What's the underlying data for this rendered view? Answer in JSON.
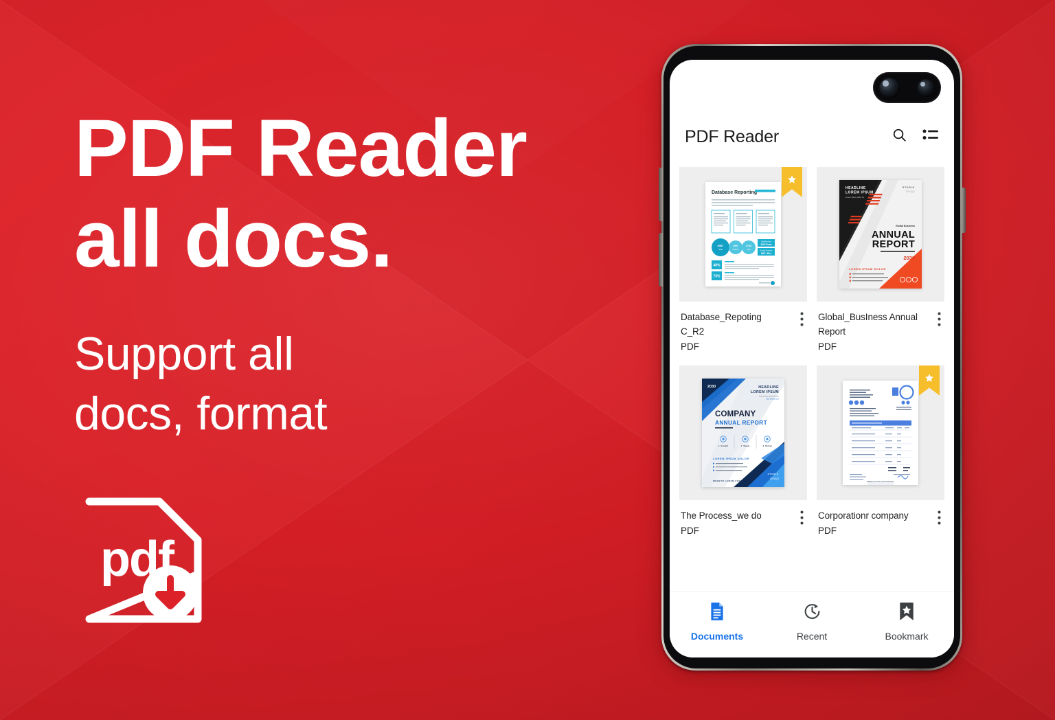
{
  "theme": {
    "background_red": "#DC2128",
    "accent_blue": "#1A73E8",
    "bookmark_yellow": "#F7BE2C",
    "text_dark": "#202124"
  },
  "hero": {
    "headline": "PDF Reader\nall docs.",
    "subheadline": "Support all\ndocs, format",
    "logo_text": "pdf",
    "logo_icon": "pdf-document-download-icon"
  },
  "phone": {
    "camera_icon": "dual-camera-punch-hole",
    "buttons": [
      "volume-up",
      "volume-down",
      "power"
    ]
  },
  "app": {
    "title": "PDF Reader",
    "actions": [
      {
        "name": "search-icon",
        "label": "Search"
      },
      {
        "name": "list-view-icon",
        "label": "List view"
      }
    ],
    "documents": [
      {
        "name": "Database_Repoting\nC_R2",
        "type": "PDF",
        "bookmarked": true,
        "thumbnail": "database-reporting-infographic",
        "thumb_title": "Database Reporting",
        "menu_icon": "kebab-menu-icon"
      },
      {
        "name": "Global_BusIness Annual\nReport",
        "type": "PDF",
        "bookmarked": false,
        "thumbnail": "annual-report-red-black-cover",
        "thumb_title": "ANNUAL REPORT",
        "thumb_subtitle": "Global Business",
        "thumb_year": "2030",
        "thumb_headline": "HEADLINE LOREM IPSUM",
        "thumb_studio": "STUDIO design",
        "thumb_footer": "LOREM IPSUM DOLOR",
        "menu_icon": "kebab-menu-icon"
      },
      {
        "name": "The Process_we do",
        "type": "PDF",
        "bookmarked": false,
        "thumbnail": "company-annual-report-blue-cover",
        "thumb_title": "COMPANY",
        "thumb_subtitle": "ANNUAL REPORT",
        "thumb_year": "2030",
        "thumb_headline": "HEADLINE LOREM IPSUM",
        "thumb_footer": "LOREM IPSUM DOLOR",
        "thumb_studio": "STUDIO design",
        "menu_icon": "kebab-menu-icon"
      },
      {
        "name": "Corporationr company",
        "type": "PDF",
        "bookmarked": true,
        "thumbnail": "invoice-blue-template",
        "menu_icon": "kebab-menu-icon"
      }
    ],
    "bottom_nav": [
      {
        "label": "Documents",
        "icon": "document-icon",
        "active": true
      },
      {
        "label": "Recent",
        "icon": "clock-icon",
        "active": false
      },
      {
        "label": "Bookmark",
        "icon": "bookmark-star-icon",
        "active": false
      }
    ]
  }
}
